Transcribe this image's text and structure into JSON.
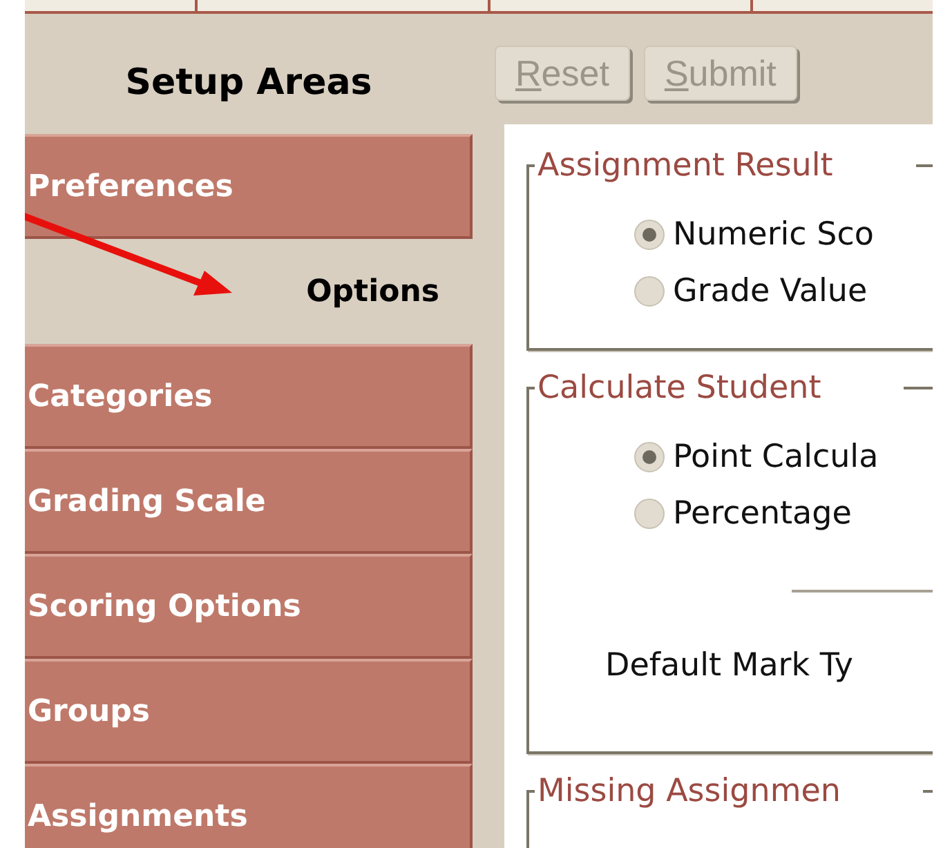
{
  "setup_areas": {
    "title": "Setup Areas",
    "items": [
      {
        "label": "Preferences",
        "selected": false
      },
      {
        "label": "Options",
        "selected": true
      },
      {
        "label": "Categories",
        "selected": false
      },
      {
        "label": "Grading Scale",
        "selected": false
      },
      {
        "label": "Scoring Options",
        "selected": false
      },
      {
        "label": "Groups",
        "selected": false
      },
      {
        "label": "Assignments",
        "selected": false
      }
    ]
  },
  "buttons": [
    {
      "label": "Reset",
      "disabled": true
    },
    {
      "label": "Submit",
      "disabled": true
    }
  ],
  "sections": [
    {
      "legend": "Assignment Result",
      "options": [
        {
          "label": "Numeric Sco",
          "selected": true
        },
        {
          "label": "Grade Value",
          "selected": false
        }
      ]
    },
    {
      "legend": "Calculate Student",
      "options": [
        {
          "label": "Point Calcula",
          "selected": true
        },
        {
          "label": "Percentage",
          "selected": false
        }
      ],
      "divider": true,
      "field_label": "Default Mark Ty"
    },
    {
      "legend": "Missing Assignmen"
    }
  ],
  "annotation": {
    "kind": "arrow"
  }
}
